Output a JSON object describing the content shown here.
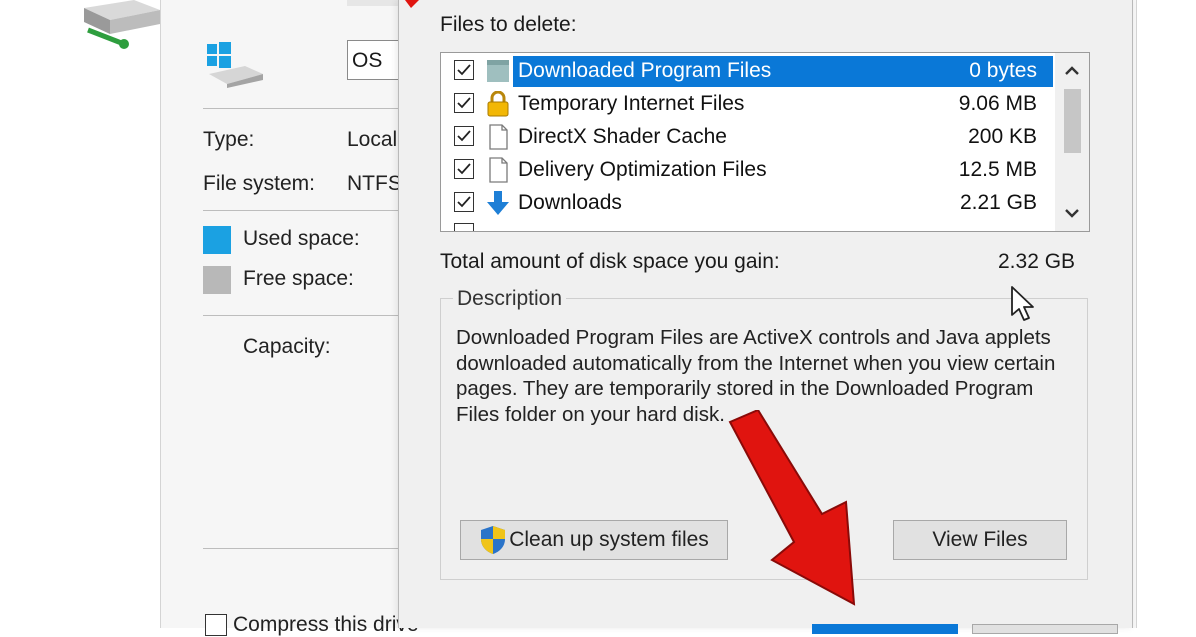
{
  "properties": {
    "drive_label_value": "OS",
    "type_label": "Type:",
    "type_value": "Local",
    "filesystem_label": "File system:",
    "filesystem_value": "NTFS",
    "used_label": "Used space:",
    "free_label": "Free space:",
    "capacity_label": "Capacity:",
    "compress_label": "Compress this drive",
    "used_color": "#1ba1e2",
    "free_color": "#b8b8b8"
  },
  "cleanup": {
    "files_to_delete_label": "Files to delete:",
    "items": [
      {
        "name": "Downloaded Program Files",
        "size": "0 bytes",
        "checked": true,
        "selected": true,
        "icon": "folder-icon"
      },
      {
        "name": "Temporary Internet Files",
        "size": "9.06 MB",
        "checked": true,
        "selected": false,
        "icon": "lock-icon"
      },
      {
        "name": "DirectX Shader Cache",
        "size": "200 KB",
        "checked": true,
        "selected": false,
        "icon": "file-icon"
      },
      {
        "name": "Delivery Optimization Files",
        "size": "12.5 MB",
        "checked": true,
        "selected": false,
        "icon": "file-icon"
      },
      {
        "name": "Downloads",
        "size": "2.21 GB",
        "checked": true,
        "selected": false,
        "icon": "download-arrow-icon"
      }
    ],
    "total_label": "Total amount of disk space you gain:",
    "total_value": "2.32 GB",
    "description_title": "Description",
    "description_text": "Downloaded Program Files are ActiveX controls and Java applets downloaded automatically from the Internet when you view certain pages. They are temporarily stored in the Downloaded Program Files folder on your hard disk.",
    "cleanup_system_button": "Clean up system files",
    "view_files_button": "View Files",
    "selection_color": "#0a78d7",
    "annotation_arrow_color": "#e0140f"
  }
}
